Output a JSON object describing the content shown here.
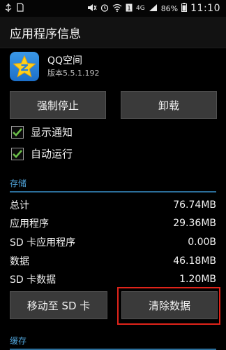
{
  "status_bar": {
    "network": "4G",
    "battery": "86%",
    "time": "11:10",
    "icons": [
      "usb-icon",
      "sd-card-icon",
      "mute-icon",
      "alarm-icon",
      "wifi-icon",
      "sim-icon",
      "signal-icon",
      "battery-icon"
    ]
  },
  "title_bar": {
    "title": "应用程序信息"
  },
  "app": {
    "name": "QQ空间",
    "version": "版本5.5.1.192",
    "icon": "qzone-star-icon"
  },
  "buttons": {
    "force_stop": "强制停止",
    "uninstall": "卸载",
    "move_to_sd": "移动至 SD 卡",
    "clear_data": "清除数据"
  },
  "checkboxes": [
    {
      "label": "显示通知",
      "checked": true
    },
    {
      "label": "自动运行",
      "checked": true
    }
  ],
  "storage": {
    "header": "存储",
    "rows": [
      {
        "label": "总计",
        "value": "76.74MB"
      },
      {
        "label": "应用程序",
        "value": "29.36MB"
      },
      {
        "label": "SD 卡应用程序",
        "value": "0.00B"
      },
      {
        "label": "数据",
        "value": "46.18MB"
      },
      {
        "label": "SD 卡数据",
        "value": "1.20MB"
      }
    ]
  },
  "cache": {
    "header": "缓存"
  },
  "colors": {
    "accent": "#4fa3d9",
    "highlight": "#e0241a",
    "checkbox_check": "#6cc04a"
  }
}
